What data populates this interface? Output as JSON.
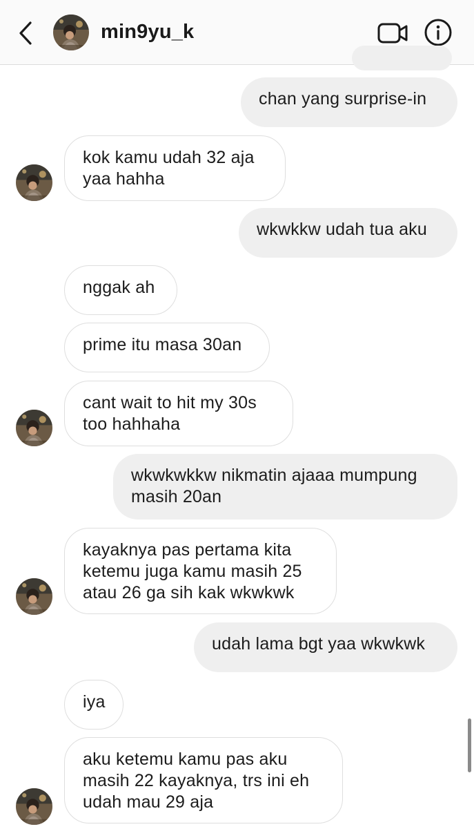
{
  "header": {
    "username": "min9yu_k",
    "back_icon": "chevron-left-icon",
    "video_icon": "video-camera-icon",
    "info_icon": "info-icon"
  },
  "messages": [
    {
      "side": "sent",
      "lines": [
        "chan yang surprise-in"
      ]
    },
    {
      "side": "recv",
      "lines": [
        "kok kamu udah 32 aja",
        "yaa hahha"
      ]
    },
    {
      "side": "sent",
      "lines": [
        "wkwkkw udah tua aku"
      ]
    },
    {
      "side": "recv",
      "lines": [
        "nggak ah"
      ]
    },
    {
      "side": "recv",
      "lines": [
        "prime itu masa 30an"
      ]
    },
    {
      "side": "recv",
      "lines": [
        "cant wait to hit my 30s",
        "too hahhaha"
      ]
    },
    {
      "side": "sent",
      "lines": [
        "wkwkwkkw nikmatin ajaaa mumpung",
        "masih 20an"
      ]
    },
    {
      "side": "recv",
      "lines": [
        "kayaknya pas pertama kita",
        "ketemu juga kamu masih 25",
        "atau 26 ga sih kak wkwkwk"
      ]
    },
    {
      "side": "sent",
      "lines": [
        "udah lama bgt yaa wkwkwk"
      ]
    },
    {
      "side": "recv",
      "lines": [
        "iya"
      ]
    },
    {
      "side": "recv",
      "lines": [
        "aku ketemu kamu pas aku",
        "masih 22 kayaknya, trs ini eh",
        "udah mau 29 aja"
      ]
    }
  ],
  "colors": {
    "sent_bubble": "#efefef",
    "recv_border": "#dedede",
    "header_bg": "#fafafa",
    "text": "#1c1c1c"
  }
}
